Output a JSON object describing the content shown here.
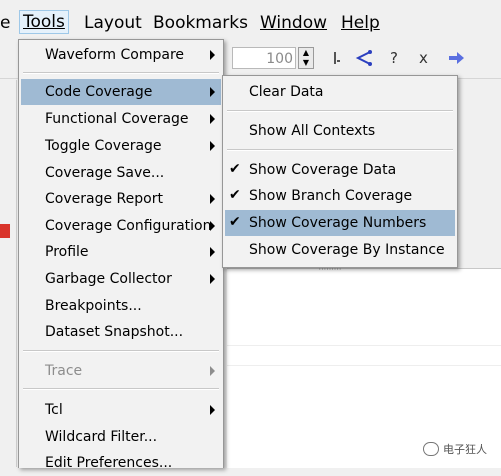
{
  "menubar": {
    "items": [
      "e",
      "Tools",
      "Layout",
      "Bookmarks",
      "Window",
      "Help"
    ]
  },
  "toolbar": {
    "zoom_value": "100"
  },
  "tools_menu": {
    "items": [
      {
        "label": "Waveform Compare",
        "submenu": true
      },
      {
        "label": "Code Coverage",
        "submenu": true,
        "highlighted": true
      },
      {
        "label": "Functional Coverage",
        "submenu": true
      },
      {
        "label": "Toggle Coverage",
        "submenu": true
      },
      {
        "label": "Coverage Save...",
        "submenu": false
      },
      {
        "label": "Coverage Report",
        "submenu": true
      },
      {
        "label": "Coverage Configuration",
        "submenu": true
      },
      {
        "label": "Profile",
        "submenu": true
      },
      {
        "label": "Garbage Collector",
        "submenu": true
      },
      {
        "label": "Breakpoints...",
        "submenu": false
      },
      {
        "label": "Dataset Snapshot...",
        "submenu": false
      },
      {
        "label": "Trace",
        "submenu": true,
        "disabled": true
      },
      {
        "label": "Tcl",
        "submenu": true
      },
      {
        "label": "Wildcard Filter...",
        "submenu": false
      },
      {
        "label": "Edit Preferences...",
        "submenu": false
      }
    ]
  },
  "code_coverage_menu": {
    "items": [
      {
        "label": "Clear Data",
        "checked": false
      },
      {
        "label": "Show All Contexts",
        "checked": false
      },
      {
        "label": "Show Coverage Data",
        "checked": true
      },
      {
        "label": "Show Branch Coverage",
        "checked": true
      },
      {
        "label": "Show Coverage Numbers",
        "checked": true,
        "highlighted": true
      },
      {
        "label": "Show Coverage By Instance",
        "checked": false
      }
    ],
    "check_glyph": "✔"
  },
  "watermark": {
    "text": "电子狂人"
  },
  "colors": {
    "menu_bg": "#f2f2f2",
    "highlight": "#9fbad3",
    "menubar_active": "#e5f1fb",
    "disabled_text": "#8d8d8d"
  }
}
